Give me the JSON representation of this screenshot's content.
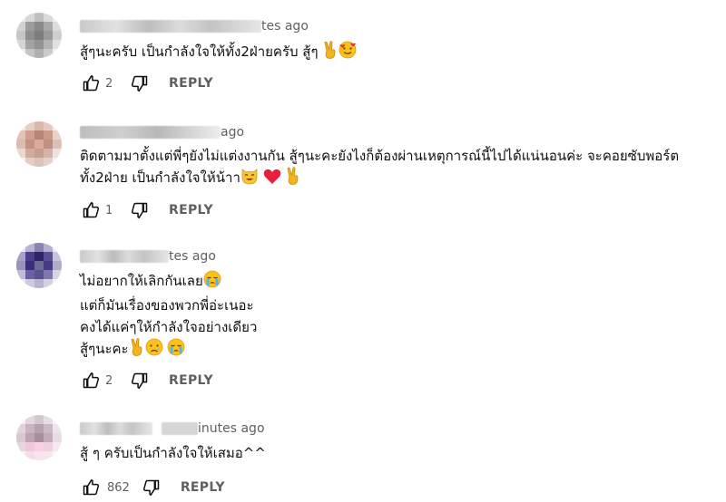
{
  "colors": {
    "text": "#0f0f0f",
    "muted": "#606060",
    "background": "#ffffff"
  },
  "comments": [
    {
      "timestamp": "tes ago",
      "lines": [
        "สู้ๆนะครับ เป็นกำลังใจให้ทั้ง2ฝ่ายครับ สู้ๆ"
      ],
      "emojis": [
        "victory-hand",
        "smiling-face-with-hearts"
      ],
      "likes": "2",
      "reply_label": "REPLY"
    },
    {
      "timestamp": "ago",
      "lines": [
        "ติดตามมาตั้งแต่พี่ๆยังไม่แต่งงานกัน สู้ๆนะคะยังไงก็ต้องผ่านเหตุการณ์นี้ไปได้แน่นอนค่ะ จะคอยซับพอร์ต",
        "ทั้ง2ฝ่าย เป็นกำลังใจให้น้าา"
      ],
      "emojis": [
        "smiling-cat",
        "red-heart",
        "victory-hand"
      ],
      "likes": "1",
      "reply_label": "REPLY"
    },
    {
      "timestamp": "tes ago",
      "lines": [
        "ไม่อยากให้เลิกกันเลย",
        "แต่ก็มันเรื่องของพวกพี่อ่ะเนอะ",
        "คงได้แค่ๆให้กำลังใจอย่างเดียว",
        "สู้ๆนะคะ"
      ],
      "emojis": [
        "crying-face",
        "victory-hand",
        "sad-face",
        "crying-face"
      ],
      "likes": "2",
      "reply_label": "REPLY"
    },
    {
      "timestamp": "inutes ago",
      "lines": [
        "สู้ ๆ ครับเป็นกำลังใจให้เสมอ^^"
      ],
      "emojis": [],
      "likes": "862",
      "reply_label": "REPLY"
    }
  ]
}
